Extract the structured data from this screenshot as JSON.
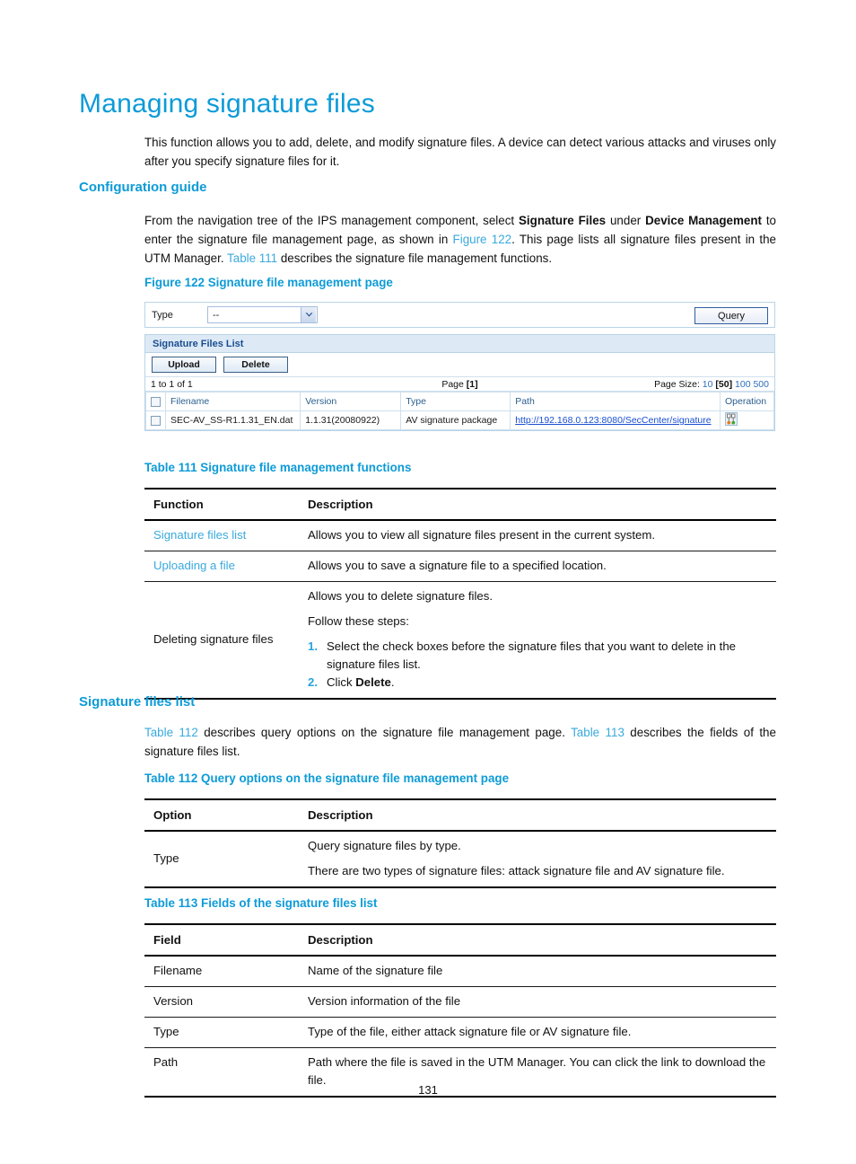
{
  "document": {
    "title": "Managing signature files",
    "page_number": "131",
    "intro_paragraph": "This function allows you to add, delete, and modify signature files. A device can detect various attacks and viruses only after you specify signature files for it.",
    "accent_color": "#0d9bd7",
    "link_color": "#3aa9dd"
  },
  "configuration_guide": {
    "heading": "Configuration guide",
    "paragraph": {
      "t1": "From the navigation tree of the IPS management component, select ",
      "b1": "Signature Files",
      "t2": " under ",
      "b2": "Device Management",
      "t3": " to enter the signature file management page, as shown in ",
      "l1": "Figure 122",
      "t4": ". This page lists all signature files present in the UTM Manager. ",
      "l2": "Table 111",
      "t5": " describes the signature file management functions."
    }
  },
  "figure_122": {
    "caption": "Figure 122 Signature file management page",
    "query_bar": {
      "type_label": "Type",
      "type_value": "--",
      "type_icon": "chevron-down-icon",
      "query_button": "Query"
    },
    "panel": {
      "title": "Signature Files List",
      "upload_button": "Upload",
      "delete_button": "Delete",
      "pager": {
        "range": "1 to 1 of 1",
        "page_label": "Page",
        "page_current": "[1]",
        "page_size_label": "Page Size:",
        "sizes": [
          "10",
          "50",
          "100",
          "500"
        ],
        "size_current": "50"
      },
      "columns": [
        "Filename",
        "Version",
        "Type",
        "Path",
        "Operation"
      ],
      "rows": [
        {
          "filename": "SEC-AV_SS-R1.1.31_EN.dat",
          "version": "1.1.31(20080922)",
          "type": "AV signature package",
          "path": "http://192.168.0.123:8080/SecCenter/signature",
          "operation_icon": "delete-scissors-icon"
        }
      ]
    }
  },
  "table_111": {
    "caption": "Table 111 Signature file management functions",
    "headers": [
      "Function",
      "Description"
    ],
    "rows": [
      {
        "function": "Signature files list",
        "function_is_link": true,
        "description": "Allows you to view all signature files present in the current system."
      },
      {
        "function": "Uploading a file",
        "function_is_link": true,
        "description": "Allows you to save a signature file to a specified location."
      },
      {
        "function": "Deleting signature files",
        "function_is_link": false,
        "description_line1": "Allows you to delete signature files.",
        "description_line2": "Follow these steps:",
        "steps": [
          {
            "num": "1.",
            "text": "Select the check boxes before the signature files that you want to delete in the signature files list."
          },
          {
            "num": "2.",
            "text_before": "Click ",
            "bold": "Delete",
            "text_after": "."
          }
        ]
      }
    ]
  },
  "signature_files_list_section": {
    "heading": "Signature files list",
    "paragraph": {
      "l1": "Table 112",
      "t1": " describes query options on the signature file management page. ",
      "l2": "Table 113",
      "t2": " describes the fields of the signature files list."
    }
  },
  "table_112": {
    "caption": "Table 112 Query options on the signature file management page",
    "headers": [
      "Option",
      "Description"
    ],
    "rows": [
      {
        "option": "Type",
        "description_line1": "Query signature files by type.",
        "description_line2": "There are two types of signature files: attack signature file and AV signature file."
      }
    ]
  },
  "table_113": {
    "caption": "Table 113 Fields of the signature files list",
    "headers": [
      "Field",
      "Description"
    ],
    "rows": [
      {
        "field": "Filename",
        "description": "Name of the signature file"
      },
      {
        "field": "Version",
        "description": "Version information of the file"
      },
      {
        "field": "Type",
        "description": "Type of the file, either attack signature file or AV signature file."
      },
      {
        "field": "Path",
        "description": "Path where the file is saved in the UTM Manager. You can click the link to download the file."
      }
    ]
  }
}
